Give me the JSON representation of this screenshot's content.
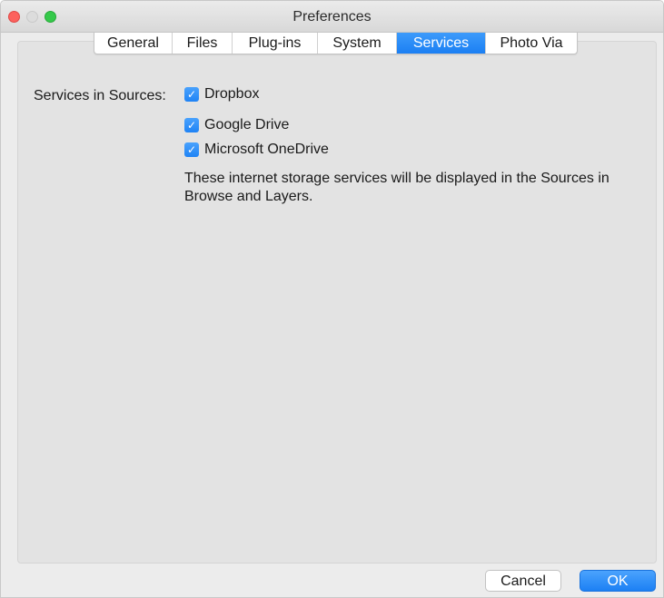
{
  "window": {
    "title": "Preferences"
  },
  "tabs": [
    {
      "label": "General",
      "active": false
    },
    {
      "label": "Files",
      "active": false
    },
    {
      "label": "Plug-ins",
      "active": false
    },
    {
      "label": "System",
      "active": false
    },
    {
      "label": "Services",
      "active": true
    },
    {
      "label": "Photo Via",
      "active": false
    }
  ],
  "services": {
    "section_label": "Services in Sources:",
    "options": [
      {
        "label": "Dropbox",
        "checked": true
      },
      {
        "label": "Google Drive",
        "checked": true
      },
      {
        "label": "Microsoft OneDrive",
        "checked": true
      }
    ],
    "description": "These internet storage services will be displayed in the Sources in Browse and Layers.",
    "check_glyph": "✓"
  },
  "buttons": {
    "cancel": "Cancel",
    "ok": "OK"
  },
  "colors": {
    "accent": "#1f83f5",
    "close": "#fc615d",
    "minimize_disabled": "#dcdcdc",
    "maximize": "#35c94a"
  }
}
